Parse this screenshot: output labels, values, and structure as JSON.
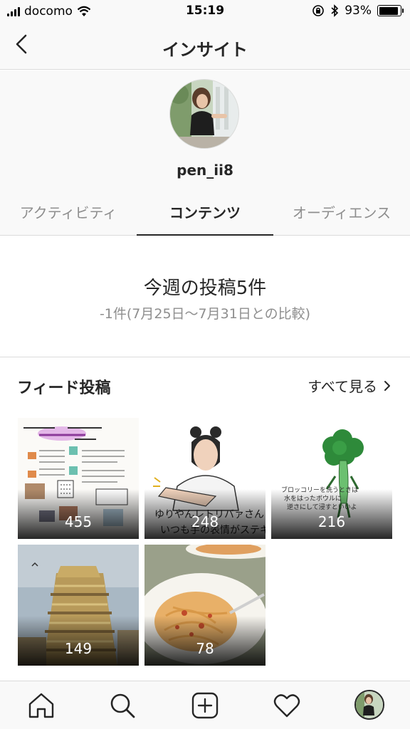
{
  "status_bar": {
    "carrier": "docomo",
    "time": "15:19",
    "battery_percent": "93%",
    "battery_level": 0.93,
    "icons": [
      "signal-icon",
      "wifi-icon",
      "orientation-lock-icon",
      "bluetooth-icon",
      "battery-icon"
    ]
  },
  "nav": {
    "title": "インサイト",
    "back_icon": "chevron-left-icon"
  },
  "profile": {
    "username": "pen_ii8"
  },
  "tabs": [
    {
      "label": "アクティビティ",
      "active": false
    },
    {
      "label": "コンテンツ",
      "active": true
    },
    {
      "label": "オーディエンス",
      "active": false
    }
  ],
  "summary": {
    "main": "今週の投稿5件",
    "sub": "-1件(7月25日〜7月31日との比較)"
  },
  "feed": {
    "title": "フィード投稿",
    "see_all": "すべて見る",
    "see_all_icon": "chevron-right-icon",
    "posts": [
      {
        "count": "455"
      },
      {
        "count": "248"
      },
      {
        "count": "216"
      },
      {
        "count": "149"
      },
      {
        "count": "78"
      }
    ]
  },
  "tab_bar": {
    "icons": [
      "home-icon",
      "search-icon",
      "new-post-icon",
      "heart-icon",
      "profile-avatar"
    ]
  },
  "colors": {
    "text_primary": "#262626",
    "text_secondary": "#8e8e8e",
    "divider": "#dbdbdb",
    "bar_background": "#f9f9f9"
  }
}
